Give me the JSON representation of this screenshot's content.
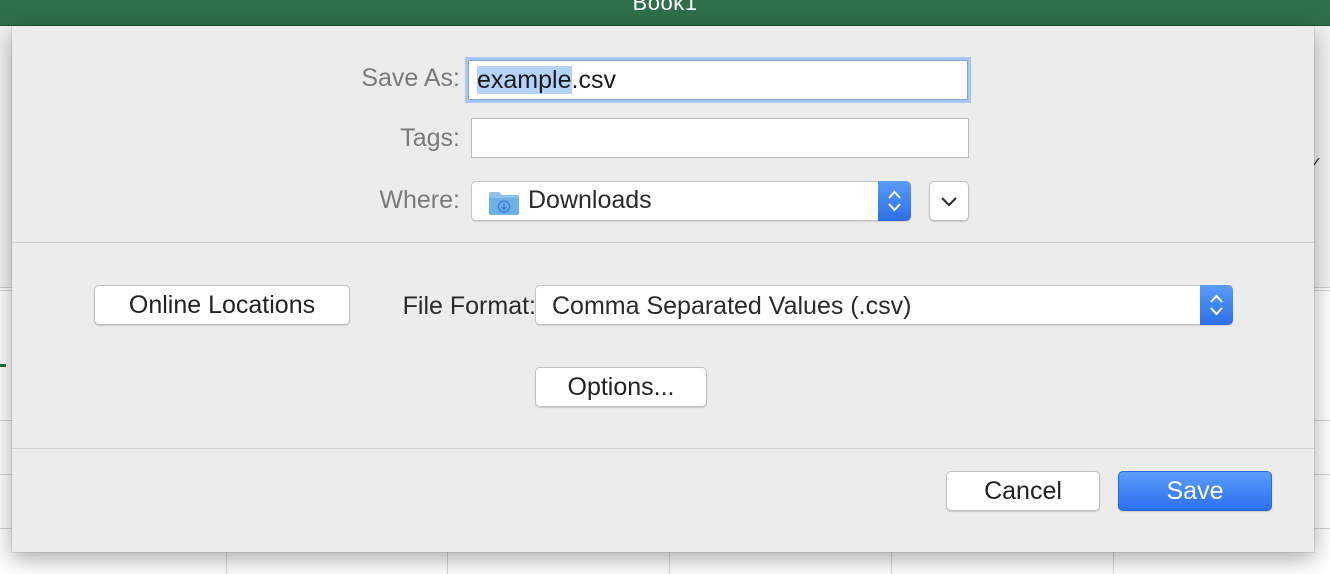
{
  "app": {
    "window_title": "Book1"
  },
  "dialog": {
    "save_as": {
      "label": "Save As:",
      "value_selected": "example",
      "value_rest": ".csv"
    },
    "tags": {
      "label": "Tags:",
      "value": ""
    },
    "where": {
      "label": "Where:",
      "value": "Downloads",
      "icon": "downloads-folder-icon"
    },
    "online_locations_label": "Online Locations",
    "file_format": {
      "label": "File Format:",
      "value": "Comma Separated Values (.csv)"
    },
    "options_label": "Options...",
    "cancel_label": "Cancel",
    "save_label": "Save"
  },
  "colors": {
    "accent": "#2c6fe8",
    "titlebar": "#2e7048",
    "dialog_bg": "#ececec",
    "selection": "#b5d3fa"
  }
}
